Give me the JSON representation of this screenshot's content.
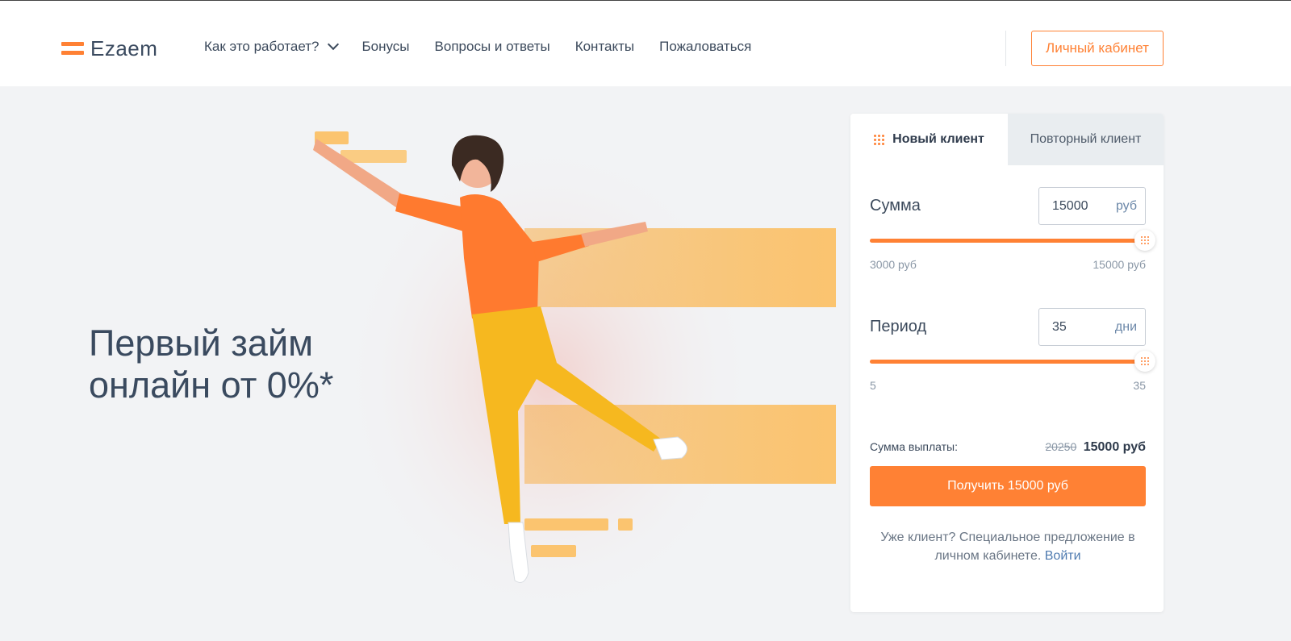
{
  "brand": {
    "name": "Ezaem",
    "accent": "#ff8134"
  },
  "nav": {
    "items": [
      {
        "label": "Как это работает?",
        "has_dropdown": true
      },
      {
        "label": "Бонусы"
      },
      {
        "label": "Вопросы и ответы"
      },
      {
        "label": "Контакты"
      },
      {
        "label": "Пожаловаться"
      }
    ],
    "cabinet_label": "Личный кабинет"
  },
  "hero": {
    "title_line1": "Первый займ",
    "title_line2": "онлайн от 0%*"
  },
  "calculator": {
    "tabs": [
      {
        "label": "Новый клиент",
        "active": true
      },
      {
        "label": "Повторный клиент",
        "active": false
      }
    ],
    "amount": {
      "label": "Сумма",
      "value": "15000",
      "unit": "руб",
      "min_label": "3000 руб",
      "max_label": "15000 руб",
      "fill_fraction": 1.0
    },
    "period": {
      "label": "Период",
      "value": "35",
      "unit": "дни",
      "min_label": "5",
      "max_label": "35",
      "fill_fraction": 1.0
    },
    "payout": {
      "label": "Сумма выплаты:",
      "old_value": "20250",
      "new_value": "15000 руб"
    },
    "submit_label": "Получить 15000 руб",
    "note_text": "Уже клиент? Специальное предложение в личном кабинете.",
    "note_link": "Войти"
  }
}
